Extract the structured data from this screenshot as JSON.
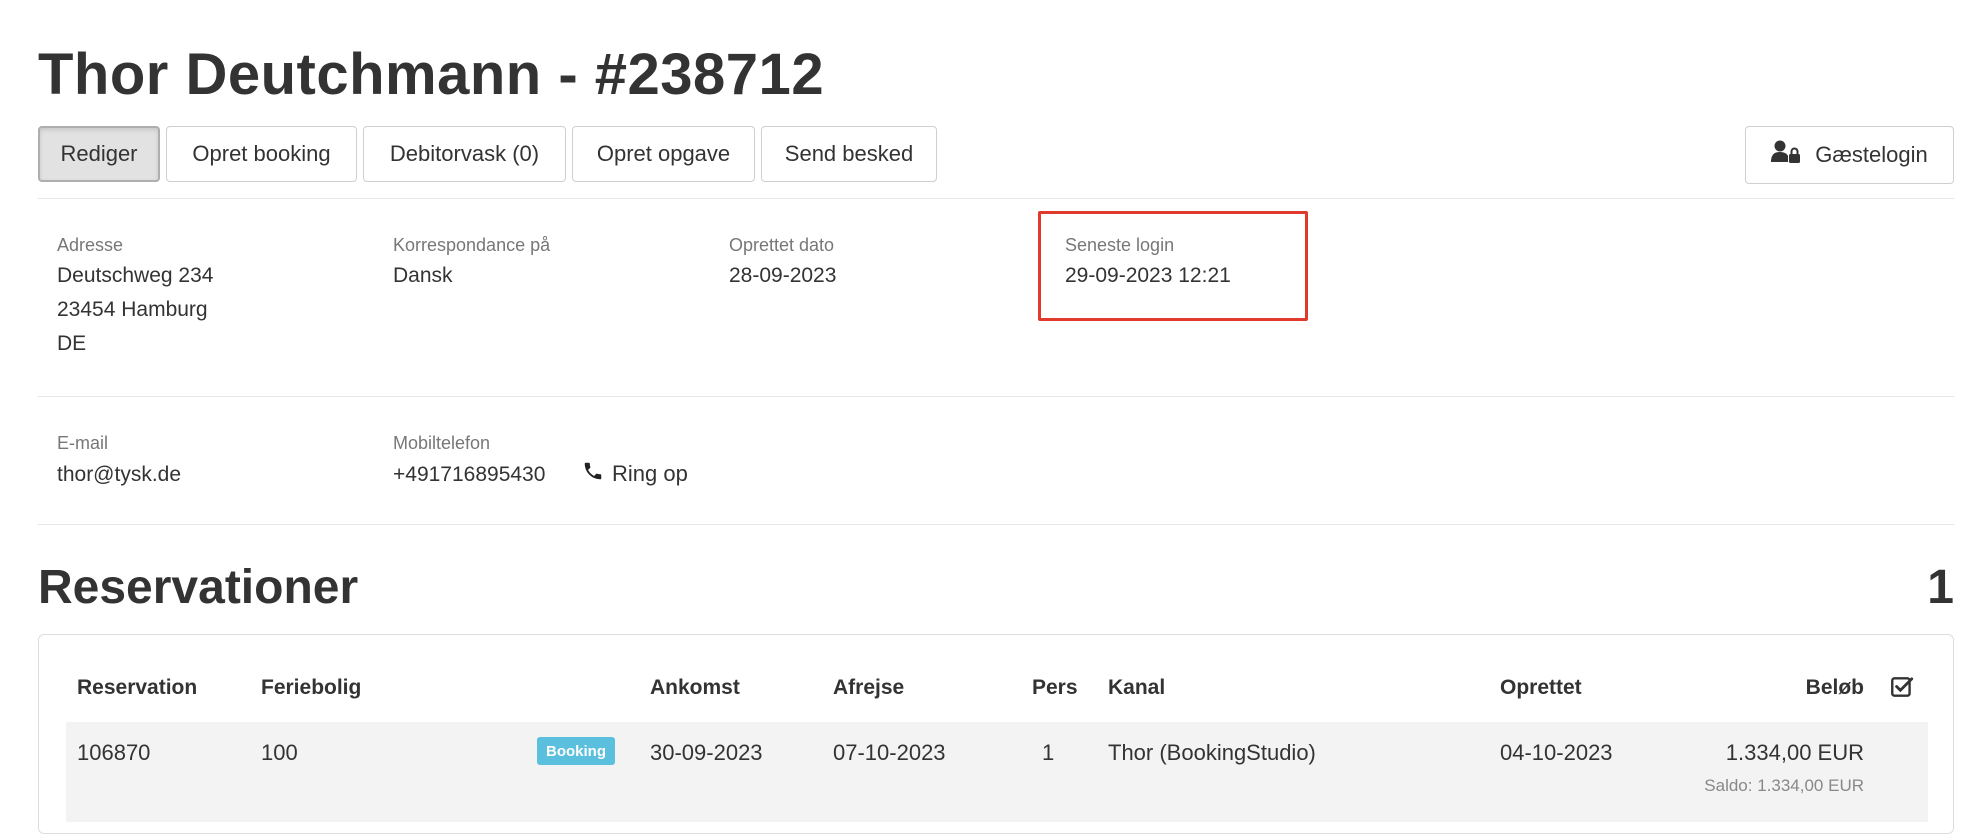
{
  "page": {
    "title": "Thor Deutchmann - #238712"
  },
  "toolbar": {
    "buttons": [
      "Rediger",
      "Opret booking",
      "Debitorvask (0)",
      "Opret opgave",
      "Send besked"
    ],
    "guest_login_label": "Gæstelogin"
  },
  "details": {
    "address_label": "Adresse",
    "address_line1": "Deutschweg 234",
    "address_line2": "23454 Hamburg",
    "address_line3": "DE",
    "correspondence_label": "Korrespondance på",
    "correspondence_value": "Dansk",
    "created_label": "Oprettet dato",
    "created_value": "28-09-2023",
    "last_login_label": "Seneste login",
    "last_login_value": "29-09-2023 12:21"
  },
  "contact": {
    "email_label": "E-mail",
    "email_value": "thor@tysk.de",
    "mobile_label": "Mobiltelefon",
    "mobile_value": "+491716895430",
    "call_label": "Ring op"
  },
  "reservations": {
    "title": "Reservationer",
    "count": "1",
    "columns": {
      "reservation": "Reservation",
      "property": "Feriebolig",
      "arrival": "Ankomst",
      "departure": "Afrejse",
      "persons": "Pers",
      "channel": "Kanal",
      "created": "Oprettet",
      "amount": "Beløb"
    },
    "rows": [
      {
        "reservation": "106870",
        "property": "100",
        "badge": "Booking",
        "arrival": "30-09-2023",
        "departure": "07-10-2023",
        "persons": "1",
        "channel": "Thor (BookingStudio)",
        "created": "04-10-2023",
        "amount": "1.334,00 EUR",
        "saldo": "Saldo: 1.334,00 EUR"
      }
    ]
  },
  "colors": {
    "highlight": "#e03a2c",
    "badge": "#5bc0de"
  }
}
